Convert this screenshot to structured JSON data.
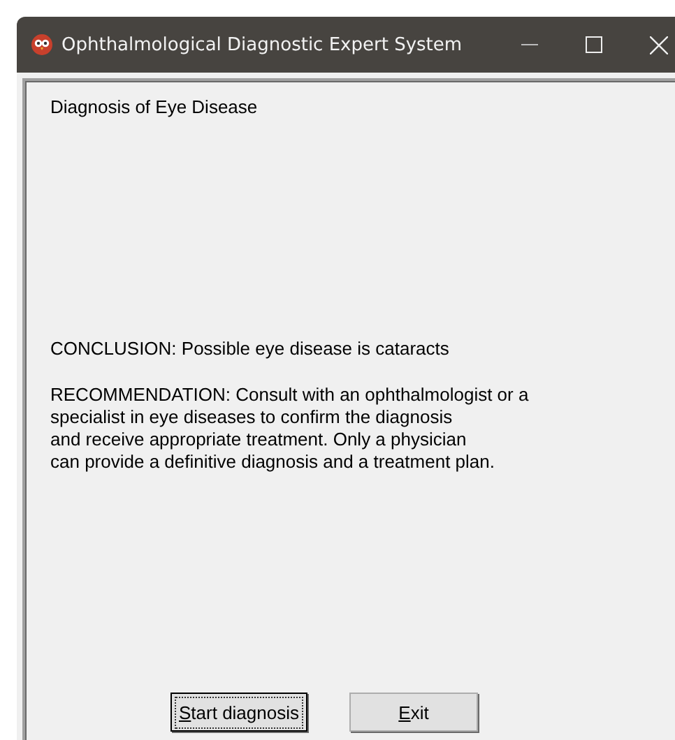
{
  "window": {
    "title": "Ophthalmological Diagnostic Expert System"
  },
  "heading": "Diagnosis of Eye Disease",
  "conclusion": "CONCLUSION: Possible eye disease is cataracts",
  "recommendation": "RECOMMENDATION: Consult with an ophthalmologist or a\nspecialist in eye diseases to confirm the diagnosis\nand receive appropriate treatment. Only a physician\ncan provide a definitive diagnosis and a treatment plan.",
  "buttons": [
    {
      "mnemonic": "S",
      "label_rest": "tart diagnosis",
      "focused": true
    },
    {
      "mnemonic": "E",
      "label_rest": "xit",
      "focused": false
    }
  ]
}
